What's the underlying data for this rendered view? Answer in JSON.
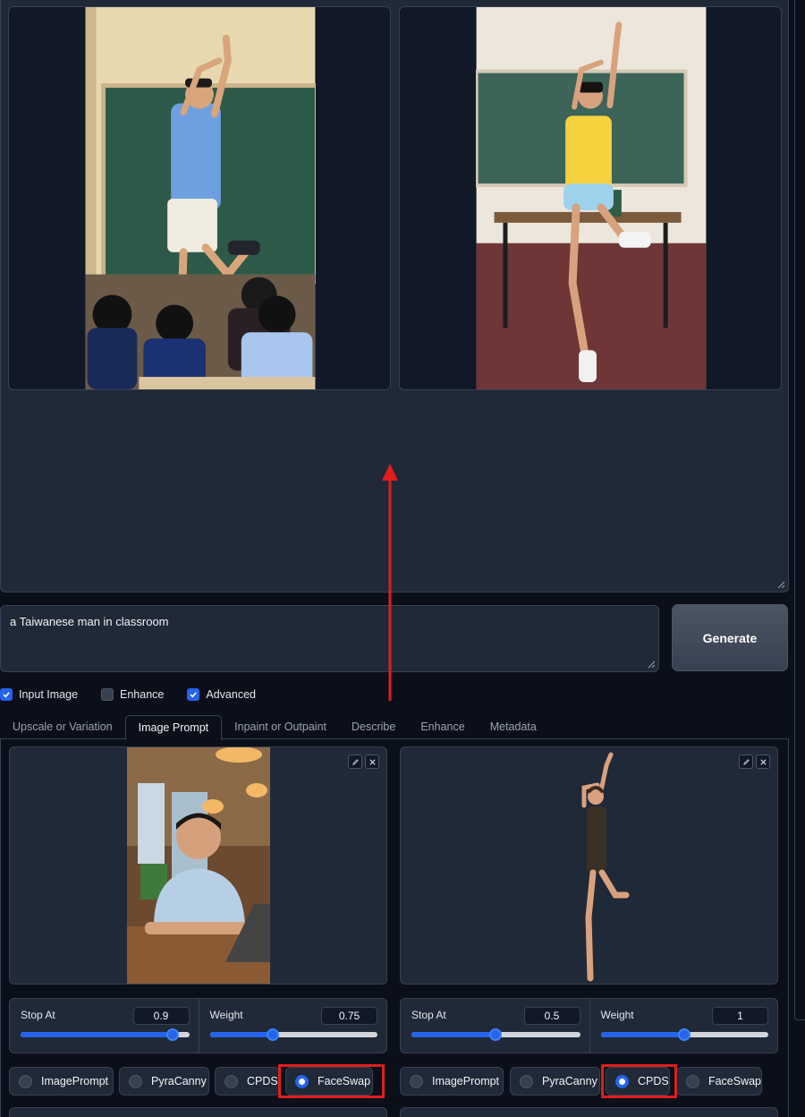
{
  "gallery": {
    "images": [
      {
        "alt": "man in blue shirt dancing in classroom with students"
      },
      {
        "alt": "woman in yellow top posing in empty classroom"
      }
    ]
  },
  "prompt": {
    "value": "a Taiwanese man in classroom"
  },
  "generate": {
    "label": "Generate"
  },
  "options": [
    {
      "label": "Input Image",
      "checked": true
    },
    {
      "label": "Enhance",
      "checked": false
    },
    {
      "label": "Advanced",
      "checked": true
    }
  ],
  "tabs": [
    {
      "label": "Upscale or Variation",
      "active": false
    },
    {
      "label": "Image Prompt",
      "active": true
    },
    {
      "label": "Inpaint or Outpaint",
      "active": false
    },
    {
      "label": "Describe",
      "active": false
    },
    {
      "label": "Enhance",
      "active": false
    },
    {
      "label": "Metadata",
      "active": false
    }
  ],
  "image_prompts": [
    {
      "stop_at": {
        "label": "Stop At",
        "value": "0.9",
        "fraction": 0.9
      },
      "weight": {
        "label": "Weight",
        "value": "0.75",
        "fraction": 0.375
      },
      "types": [
        "ImagePrompt",
        "PyraCanny",
        "CPDS",
        "FaceSwap"
      ],
      "selected": "FaceSwap"
    },
    {
      "stop_at": {
        "label": "Stop At",
        "value": "0.5",
        "fraction": 0.5
      },
      "weight": {
        "label": "Weight",
        "value": "1",
        "fraction": 0.5
      },
      "types": [
        "ImagePrompt",
        "PyraCanny",
        "CPDS",
        "FaceSwap"
      ],
      "selected": "CPDS"
    }
  ],
  "colors": {
    "accent": "#2563eb",
    "highlight": "#e11d1d",
    "panel": "#1f2937",
    "background": "#0b0f19"
  },
  "icons": {
    "edit": "pencil-icon",
    "close": "close-icon",
    "check": "checkmark-icon",
    "resize": "resize-grip-icon"
  }
}
